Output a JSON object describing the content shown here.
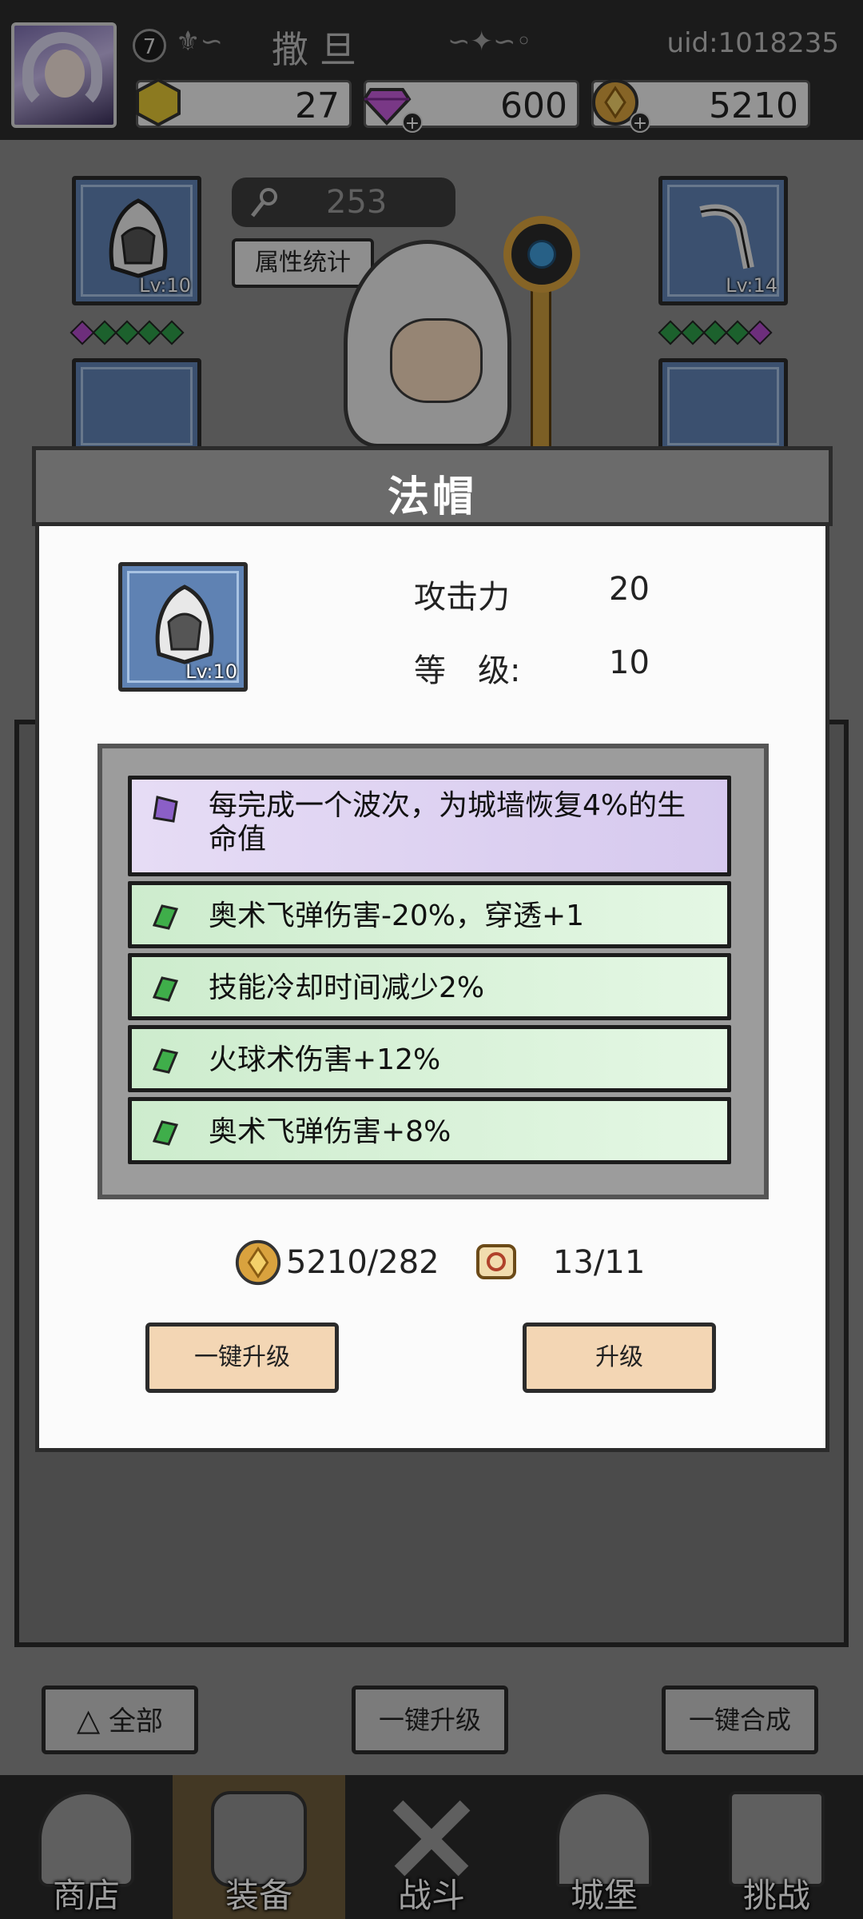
{
  "header": {
    "avatar_icon": "player-avatar",
    "level": "7",
    "username": "撒旦",
    "uid": "uid:1018235"
  },
  "resources": {
    "energy": "27",
    "gems": "600",
    "gold": "5210"
  },
  "equipment": {
    "power_value": "253",
    "stats_button": "属性统计",
    "slots": [
      {
        "name": "hat",
        "level": "Lv:10"
      },
      {
        "name": "weapon",
        "level": "Lv:14"
      }
    ]
  },
  "modal": {
    "title": "法帽",
    "item_level_badge": "Lv:10",
    "stats": [
      {
        "label": "攻击力",
        "value": "20"
      },
      {
        "label": "等　级:",
        "value": "10"
      }
    ],
    "affixes": [
      {
        "text": "每完成一个波次，为城墙恢复4%的生命值",
        "tier": "purple"
      },
      {
        "text": "奥术飞弹伤害-20%，穿透+1",
        "tier": "green"
      },
      {
        "text": "技能冷却时间减少2%",
        "tier": "green"
      },
      {
        "text": "火球术伤害+12%",
        "tier": "green"
      },
      {
        "text": "奥术飞弹伤害+8%",
        "tier": "green"
      }
    ],
    "cost_gold": "5210/282",
    "cost_scroll": "13/11",
    "btn_upgrade_all": "一键升级",
    "btn_upgrade": "升级"
  },
  "toolbar": {
    "filter_label": "全部",
    "upgrade_all": "一键升级",
    "merge_all": "一键合成"
  },
  "nav": [
    {
      "label": "商店",
      "icon": "shop-icon"
    },
    {
      "label": "装备",
      "icon": "backpack-icon"
    },
    {
      "label": "战斗",
      "icon": "swords-icon"
    },
    {
      "label": "城堡",
      "icon": "castle-icon"
    },
    {
      "label": "挑战",
      "icon": "challenge-icon"
    }
  ],
  "colors": {
    "purple_gem": "#8b5fc7",
    "green_gem": "#3fae4a",
    "gold": "#d9a23e"
  }
}
